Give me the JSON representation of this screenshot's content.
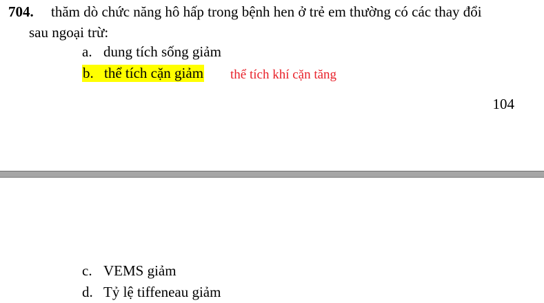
{
  "question": {
    "number": "704.",
    "text_line1": "thăm dò chức năng hô hấp trong bệnh hen ở trẻ em thường có các thay đổi",
    "text_line2": "sau ngoại trừ:"
  },
  "options": [
    {
      "letter": "a.",
      "text": "dung tích sống giảm",
      "highlighted": false
    },
    {
      "letter": "b.",
      "text": "thể tích cặn giảm",
      "highlighted": true
    },
    {
      "letter": "c.",
      "text": "VEMS giảm",
      "highlighted": false
    },
    {
      "letter": "d.",
      "text": "Tỷ lệ tiffeneau giảm",
      "highlighted": false
    }
  ],
  "annotation": {
    "text": "thể tích khí cặn tăng",
    "color": "#e8212a"
  },
  "page_number": "104",
  "colors": {
    "highlight": "#ffff00",
    "page_break": "#a6a6a6"
  }
}
